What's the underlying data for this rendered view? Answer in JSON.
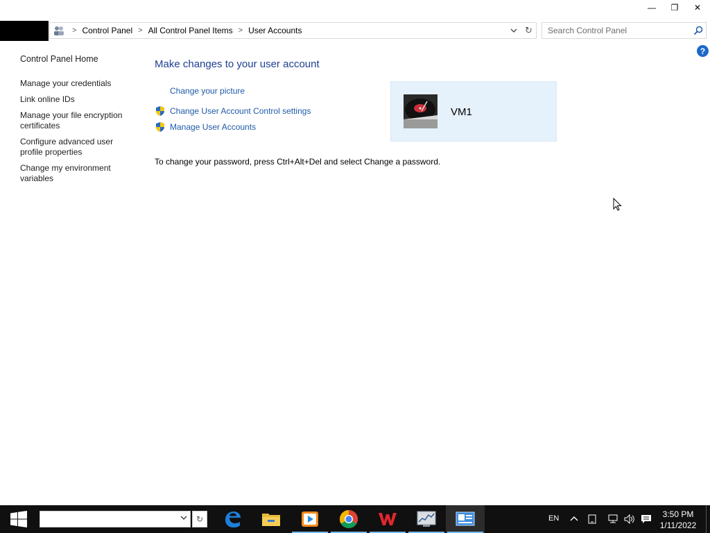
{
  "window": {
    "minimize_glyph": "—",
    "maximize_glyph": "❐",
    "close_glyph": "✕"
  },
  "address": {
    "crumbs": [
      "Control Panel",
      "All Control Panel Items",
      "User Accounts"
    ],
    "separator": ">"
  },
  "search": {
    "placeholder": "Search Control Panel"
  },
  "help": {
    "glyph": "?"
  },
  "sidebar": {
    "home": "Control Panel Home",
    "links": [
      "Manage your credentials",
      "Link online IDs",
      "Manage your file encryption certificates",
      "Configure advanced user profile properties",
      "Change my environment variables"
    ]
  },
  "main": {
    "heading": "Make changes to your user account",
    "tasks": [
      "Change your picture",
      "Change User Account Control settings",
      "Manage User Accounts"
    ],
    "note": "To change your password, press Ctrl+Alt+Del and select Change a password."
  },
  "user": {
    "name": "VM1"
  },
  "taskbar": {
    "apps": [
      "edge-icon",
      "file-explorer-icon",
      "media-player-icon",
      "chrome-icon",
      "wps-office-icon",
      "performance-monitor-icon",
      "control-panel-icon"
    ],
    "language": "EN",
    "time": "3:50 PM",
    "date": "1/11/2022"
  },
  "colors": {
    "link": "#1e5aa8",
    "heading": "#1e3f8f",
    "card": "#e5f1fb",
    "taskbar": "#101010"
  }
}
